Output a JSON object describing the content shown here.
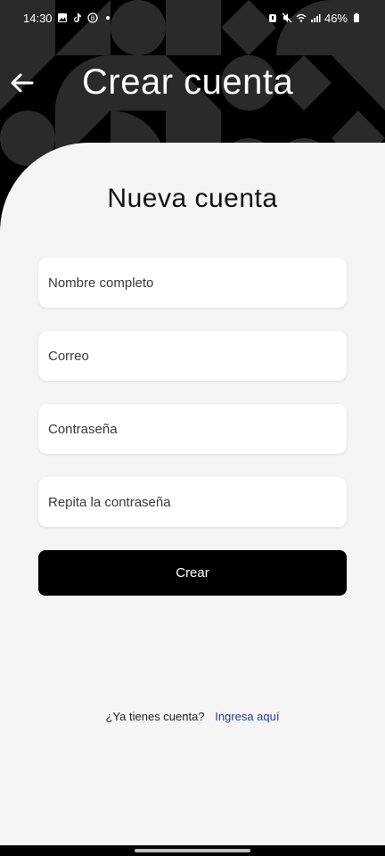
{
  "status_bar": {
    "time": "14:30",
    "battery": "46%",
    "left_icons": [
      "image-icon",
      "tiktok-icon",
      "b-badge-icon",
      "dot-icon"
    ],
    "right_icons": [
      "alarm-icon",
      "mute-icon",
      "wifi-icon",
      "signal-icon",
      "battery-icon"
    ]
  },
  "header": {
    "title": "Crear cuenta",
    "back_icon": "arrow-left-icon"
  },
  "form": {
    "title": "Nueva cuenta",
    "fields": {
      "name_placeholder": "Nombre completo",
      "email_placeholder": "Correo",
      "password_placeholder": "Contraseña",
      "repeat_password_placeholder": "Repita la contraseña"
    },
    "submit_label": "Crear"
  },
  "footer": {
    "prompt": "¿Ya tienes cuenta?",
    "link": "Ingresa aquí"
  },
  "colors": {
    "header_bg": "#000000",
    "card_bg": "#f5f5f5",
    "button_bg": "#000000",
    "link": "#2e3b9a"
  }
}
